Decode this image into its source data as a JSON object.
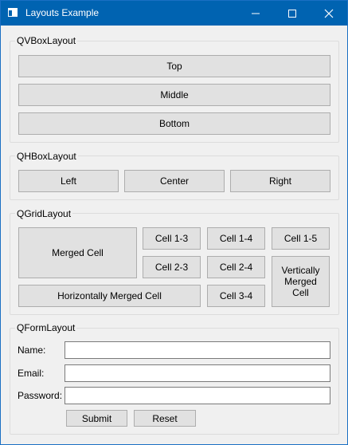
{
  "window": {
    "title": "Layouts Example"
  },
  "vbox": {
    "title": "QVBoxLayout",
    "buttons": [
      "Top",
      "Middle",
      "Bottom"
    ]
  },
  "hbox": {
    "title": "QHBoxLayout",
    "buttons": [
      "Left",
      "Center",
      "Right"
    ]
  },
  "grid": {
    "title": "QGridLayout",
    "merged": "Merged Cell",
    "cell_1_3": "Cell 1-3",
    "cell_1_4": "Cell 1-4",
    "cell_1_5": "Cell 1-5",
    "cell_2_3": "Cell 2-3",
    "cell_2_4": "Cell 2-4",
    "vertical": "Vertically Merged Cell",
    "horizontal": "Horizontally Merged Cell",
    "cell_3_4": "Cell 3-4"
  },
  "form": {
    "title": "QFormLayout",
    "name_label": "Name:",
    "name_value": "",
    "email_label": "Email:",
    "email_value": "",
    "password_label": "Password:",
    "password_value": "",
    "submit": "Submit",
    "reset": "Reset"
  }
}
